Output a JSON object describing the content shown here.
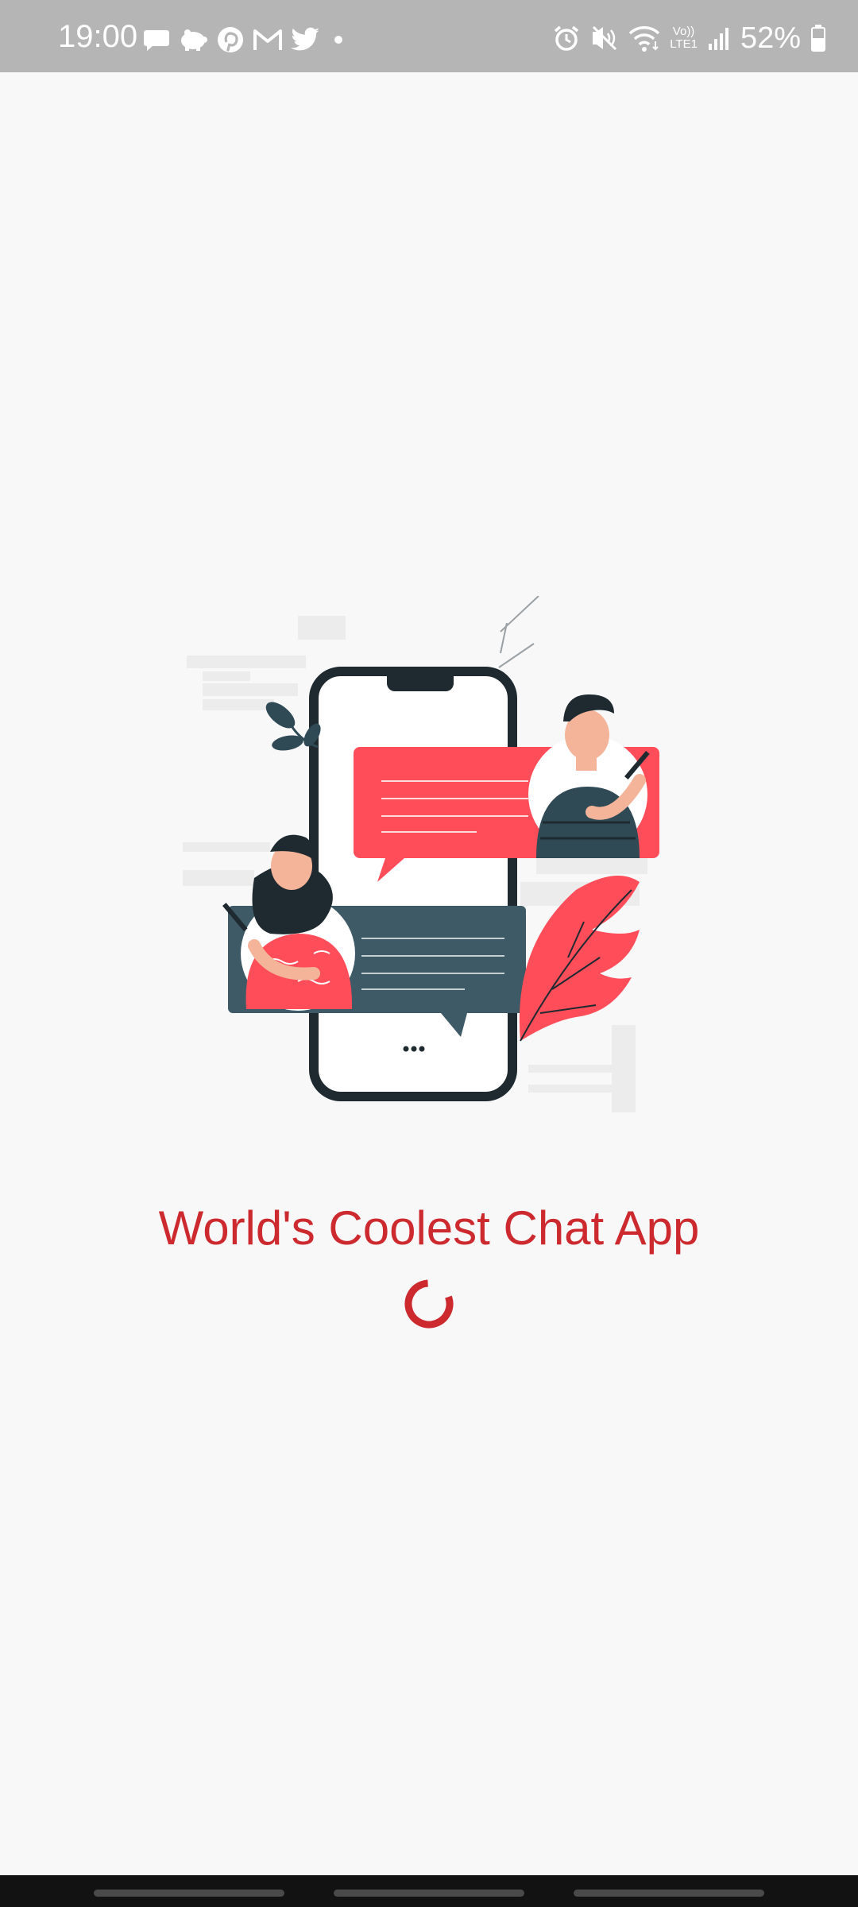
{
  "status_bar": {
    "time": "19:00",
    "battery_percent": "52%",
    "notification_icons": [
      "message-icon",
      "piggy-bank-icon",
      "pinterest-icon",
      "gmail-icon",
      "twitter-icon",
      "more-dot-icon"
    ],
    "system_icons": [
      "alarm-icon",
      "vibrate-mute-icon",
      "wifi-icon",
      "volte-icon",
      "signal-icon",
      "battery-icon"
    ],
    "volte_label_top": "Vo))",
    "volte_label_bottom": "LTE1"
  },
  "splash": {
    "title": "World's Coolest Chat App",
    "illustration": "chat-illustration",
    "loading": true
  },
  "colors": {
    "accent": "#cc2a2f",
    "bubble_red": "#ff4d5a",
    "bubble_dark": "#3d5a66",
    "phone_frame": "#1e2a30",
    "background": "#f8f8f9",
    "status_bar": "#b5b5b5"
  },
  "nav_bar": {
    "handles": [
      "recent-apps",
      "home",
      "back"
    ]
  }
}
